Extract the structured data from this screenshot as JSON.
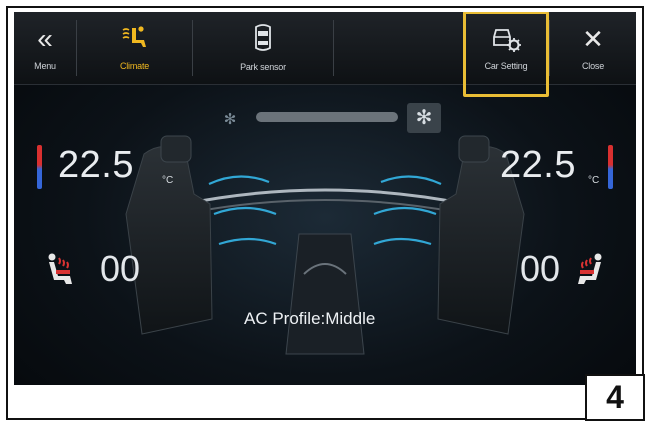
{
  "topbar": {
    "menu": {
      "label": "Menu",
      "icon": "double-chevron-left-icon"
    },
    "climate": {
      "label": "Climate",
      "icon": "seat-airflow-icon"
    },
    "park_sensor": {
      "label": "Park sensor",
      "icon": "car-top-view-icon"
    },
    "car_setting": {
      "label": "Car Setting",
      "icon": "car-gear-icon"
    },
    "close": {
      "label": "Close",
      "icon": "close-icon"
    }
  },
  "accent_color": "#f0b820",
  "highlight_color": "#e9bd35",
  "fan": {
    "level_fraction": 0.0
  },
  "left": {
    "temp": "22.5",
    "unit": "°C",
    "seat_heat": "00"
  },
  "right": {
    "temp": "22.5",
    "unit": "°C",
    "seat_heat": "00"
  },
  "profile": "AC Profile:Middle",
  "page_number": "4"
}
